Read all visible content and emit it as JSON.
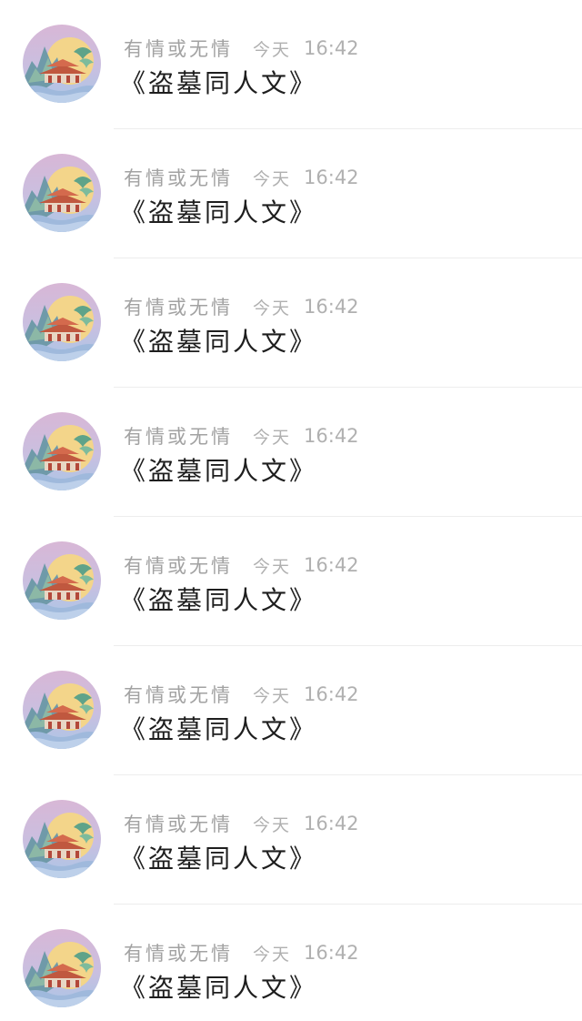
{
  "items": [
    {
      "sender": "有情或无情",
      "day": "今天",
      "time": "16:42",
      "message": "《盗墓同人文》",
      "avatar_icon": "palace-moon-painting-icon"
    },
    {
      "sender": "有情或无情",
      "day": "今天",
      "time": "16:42",
      "message": "《盗墓同人文》",
      "avatar_icon": "palace-moon-painting-icon"
    },
    {
      "sender": "有情或无情",
      "day": "今天",
      "time": "16:42",
      "message": "《盗墓同人文》",
      "avatar_icon": "palace-moon-painting-icon"
    },
    {
      "sender": "有情或无情",
      "day": "今天",
      "time": "16:42",
      "message": "《盗墓同人文》",
      "avatar_icon": "palace-moon-painting-icon"
    },
    {
      "sender": "有情或无情",
      "day": "今天",
      "time": "16:42",
      "message": "《盗墓同人文》",
      "avatar_icon": "palace-moon-painting-icon"
    },
    {
      "sender": "有情或无情",
      "day": "今天",
      "time": "16:42",
      "message": "《盗墓同人文》",
      "avatar_icon": "palace-moon-painting-icon"
    },
    {
      "sender": "有情或无情",
      "day": "今天",
      "time": "16:42",
      "message": "《盗墓同人文》",
      "avatar_icon": "palace-moon-painting-icon"
    },
    {
      "sender": "有情或无情",
      "day": "今天",
      "time": "16:42",
      "message": "《盗墓同人文》",
      "avatar_icon": "palace-moon-painting-icon"
    }
  ],
  "colors": {
    "sender": "#a2a2a2",
    "timestamp": "#b0b0b0",
    "message": "#1e1e1e",
    "divider": "#ededed",
    "avatar_sky": "#c9b6d8",
    "avatar_moon": "#f3d58a",
    "avatar_roof": "#c0583f",
    "avatar_mountain": "#6f9aa9"
  }
}
